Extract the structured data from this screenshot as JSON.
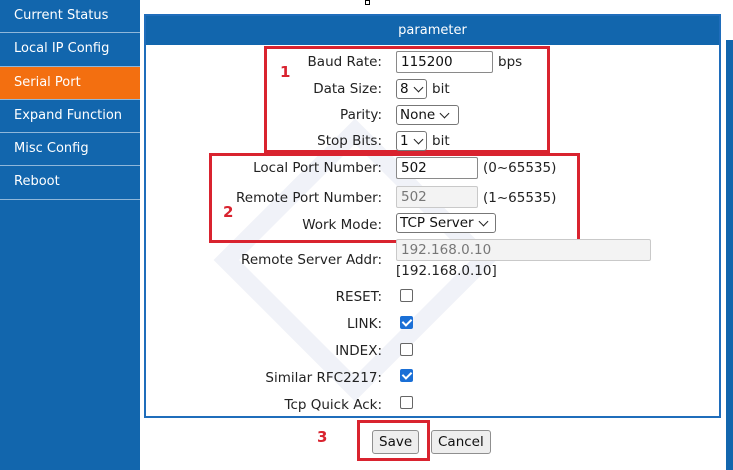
{
  "sidebar": {
    "items": [
      {
        "label": "Current Status"
      },
      {
        "label": "Local IP Config"
      },
      {
        "label": "Serial Port"
      },
      {
        "label": "Expand Function"
      },
      {
        "label": "Misc Config"
      },
      {
        "label": "Reboot"
      }
    ],
    "active_index": 2
  },
  "panel": {
    "title": "parameter"
  },
  "fields": {
    "baud_rate": {
      "label": "Baud Rate:",
      "value": "115200",
      "unit": "bps"
    },
    "data_size": {
      "label": "Data Size:",
      "value": "8",
      "unit": "bit"
    },
    "parity": {
      "label": "Parity:",
      "value": "None"
    },
    "stop_bits": {
      "label": "Stop Bits:",
      "value": "1",
      "unit": "bit"
    },
    "local_port": {
      "label": "Local Port Number:",
      "value": "502",
      "range": "(0~65535)"
    },
    "remote_port": {
      "label": "Remote Port Number:",
      "value": "502",
      "range": "(1~65535)"
    },
    "work_mode": {
      "label": "Work Mode:",
      "value": "TCP Server"
    },
    "remote_server": {
      "label": "Remote Server Addr:",
      "value": "192.168.0.10",
      "current": "[192.168.0.10]"
    },
    "reset": {
      "label": "RESET:",
      "checked": false
    },
    "link": {
      "label": "LINK:",
      "checked": true
    },
    "index": {
      "label": "INDEX:",
      "checked": false
    },
    "rfc2217": {
      "label": "Similar RFC2217:",
      "checked": true
    },
    "tcp_quick_ack": {
      "label": "Tcp Quick Ack:",
      "checked": false
    }
  },
  "annotations": [
    "1",
    "2",
    "3"
  ],
  "buttons": {
    "save": "Save",
    "cancel": "Cancel"
  },
  "colors": {
    "brand_blue": "#1266ad",
    "active_orange": "#f36f10",
    "annotation_red": "#d9232f",
    "checkbox_blue": "#1a6fd6"
  }
}
